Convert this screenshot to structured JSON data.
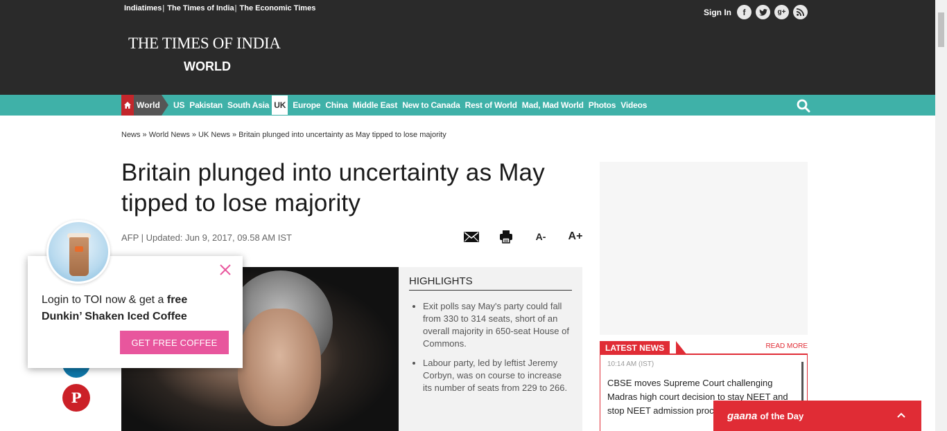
{
  "header": {
    "top_links": [
      "Indiatimes",
      "The Times of India",
      "The Economic Times"
    ],
    "sign_in": "Sign In",
    "logo": "THE TIMES OF INDIA",
    "section": "WORLD"
  },
  "nav": {
    "home_label": "World",
    "items": [
      "US",
      "Pakistan",
      "South Asia",
      "UK",
      "Europe",
      "China",
      "Middle East",
      "New to Canada",
      "Rest of World",
      "Mad, Mad World",
      "Photos",
      "Videos"
    ],
    "active": "UK"
  },
  "breadcrumb": "News » World News » UK News » Britain plunged into uncertainty as May tipped to lose majority",
  "article": {
    "headline": "Britain plunged into uncertainty as May tipped to lose majority",
    "byline": "AFP | Updated: Jun 9, 2017, 09.58 AM IST",
    "font_minus": "A-",
    "font_plus": "A+"
  },
  "highlights": {
    "title": "HIGHLIGHTS",
    "items": [
      "Exit polls say May's party could fall from 330 to 314 seats, short of an overall majority in 650-seat House of Commons.",
      "Labour party, led by leftist Jeremy Corbyn, was on course to increase its number of seats from 229 to 266."
    ]
  },
  "latest": {
    "title": "LATEST NEWS",
    "read_more": "READ MORE",
    "time": "10:14 AM (IST)",
    "text": "CBSE moves Supreme Court challenging Madras high court decision to stay NEET and stop NEET admission process"
  },
  "gaana": {
    "brand": "gaana",
    "text": "of the Day"
  },
  "promo": {
    "text_plain": "Login to TOI now & get a ",
    "text_bold1": "free",
    "text_bold2": "Dunkin’ Shaken Iced Coffee",
    "button": "GET FREE COFFEE"
  },
  "social_left": [
    "in",
    "P"
  ],
  "colors": {
    "header_bg": "#2a2a2a",
    "nav_bg": "#3fb1a8",
    "accent_red": "#e02c35",
    "promo_button": "#e8569d"
  }
}
